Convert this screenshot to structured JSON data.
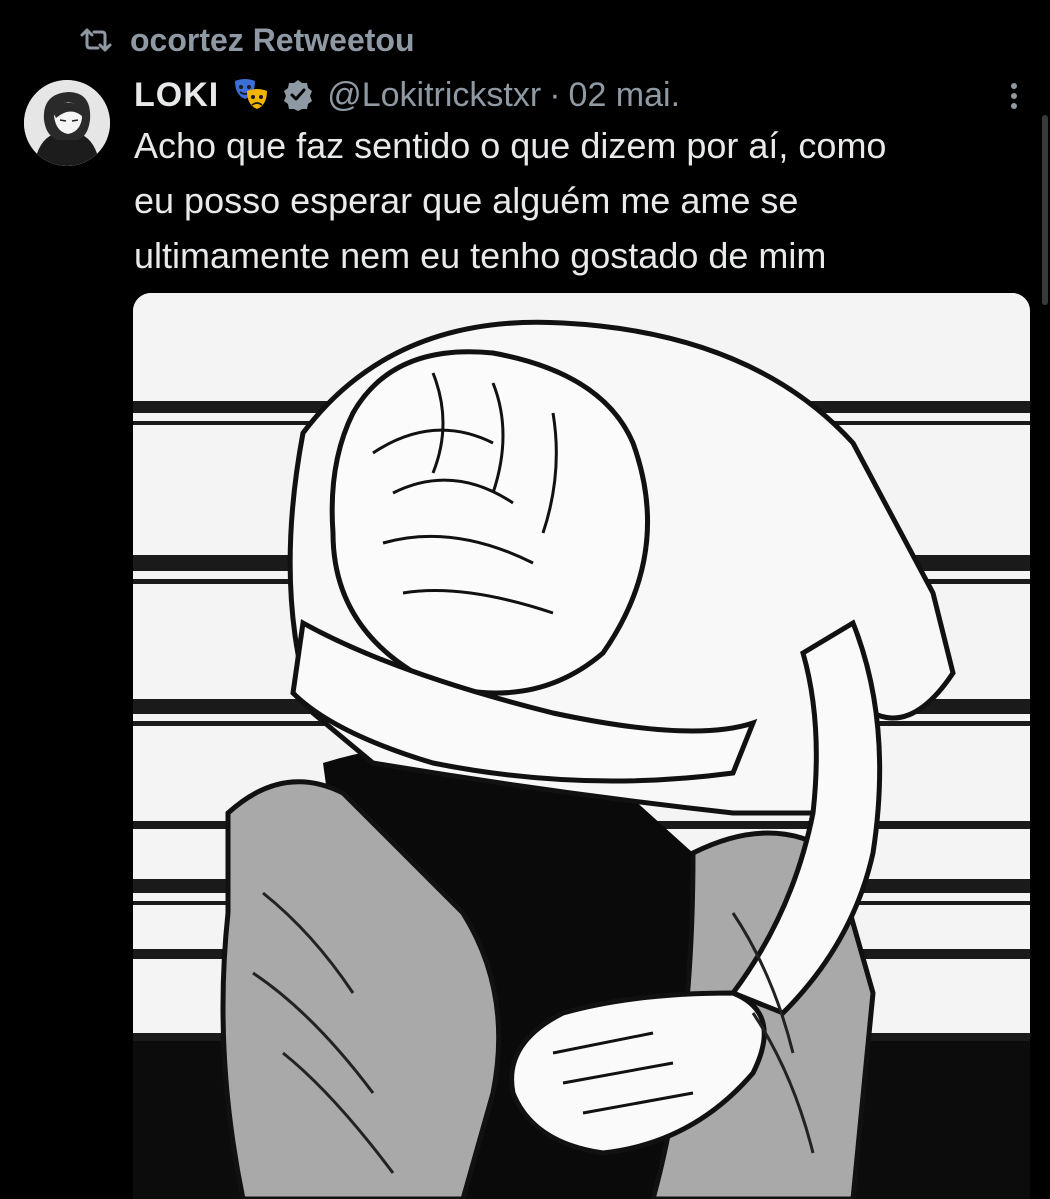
{
  "retweet": {
    "icon": "retweet-icon",
    "text": "ocortez Retweetou"
  },
  "tweet": {
    "avatar_icon": "anime-avatar",
    "display_name": "LOKI",
    "emoji_icon": "performing-arts-emoji",
    "verified_icon": "verified-badge-icon",
    "handle": "@Lokitrickstxr",
    "separator": "·",
    "date": "02 mai.",
    "more_icon": "more-options-icon",
    "text_lines": [
      "Acho que faz sentido o que dizem por aí, como",
      "eu posso esperar que alguém me ame se",
      "ultimamente nem eu tenho gostado de mim"
    ],
    "media": {
      "type": "manga-panel-image",
      "description_icon": "sad-figure-illustration"
    }
  },
  "colors": {
    "background": "#000000",
    "primary_text": "#e7e9ea",
    "secondary_text": "#8f99a3",
    "verified": "#8f99a3"
  }
}
